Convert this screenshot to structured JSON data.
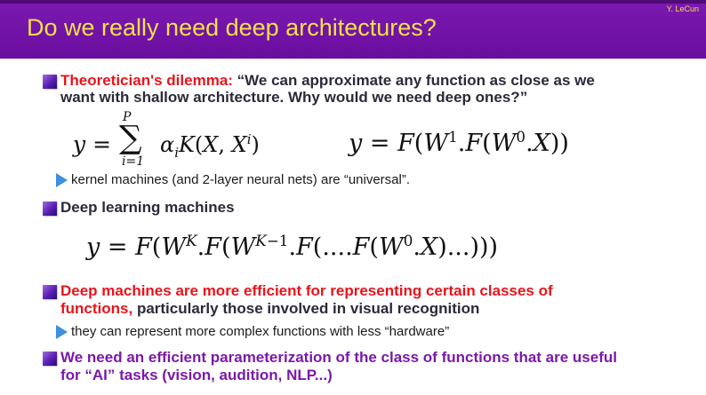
{
  "header": {
    "title": "Do we really need deep architectures?",
    "author": "Y. LeCun"
  },
  "bullets": [
    {
      "heading": "Theoretician's dilemma:",
      "text_line1": " “We can approximate any function as close as we",
      "text_line2": "want with shallow architecture. Why would we need deep ones?”"
    },
    {
      "sub": "kernel machines (and 2-layer neural nets) are “universal”."
    },
    {
      "heading": "Deep learning machines"
    },
    {
      "heading_line1": "Deep machines are more efficient for representing certain classes of",
      "heading_line2": "functions,",
      "text_line2": " particularly those involved in visual recognition"
    },
    {
      "sub": "they can represent more complex functions with less “hardware”"
    },
    {
      "heading_line1": "We need an efficient parameterization of the class of functions that are useful",
      "heading_line2": "for “AI” tasks (vision, audition, NLP...)"
    }
  ],
  "equations": {
    "sum_lhs": "y =",
    "sum_upper": "P",
    "sum_lower": "i=1",
    "sum_term": "αᵢK(X, Xⁱ)",
    "shallow": "y = F(W¹.F(W⁰.X))",
    "deep": "y = F(Wᴷ.F(Wᴷ⁻¹.F(....F(W⁰.X)...)))"
  }
}
